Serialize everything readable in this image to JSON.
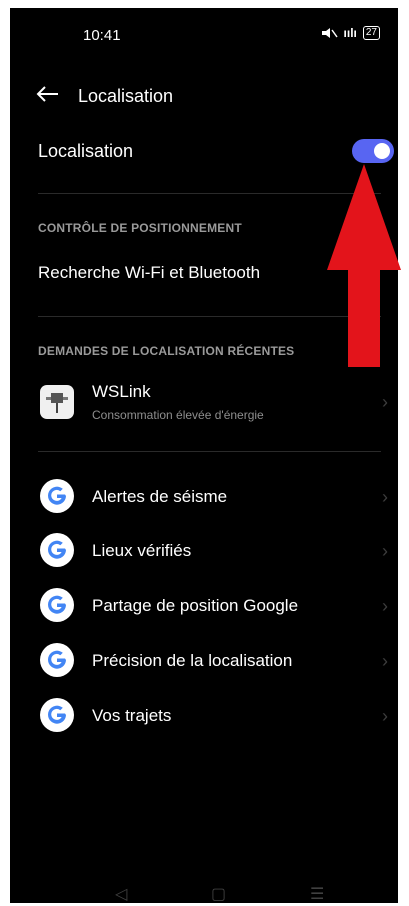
{
  "status": {
    "time": "10:41",
    "battery": "27",
    "signal": "ıılı"
  },
  "header": {
    "title": "Localisation"
  },
  "location_toggle": {
    "label": "Localisation",
    "on": true,
    "accent": "#5865F2"
  },
  "section_control": {
    "title": "CONTRÔLE DE POSITIONNEMENT",
    "item": "Recherche Wi-Fi et Bluetooth"
  },
  "section_recent": {
    "title": "DEMANDES DE LOCALISATION RÉCENTES",
    "wslink": {
      "name": "WSLink",
      "detail": "Consommation élevée d'énergie"
    }
  },
  "google_services": [
    {
      "label": "Alertes de séisme"
    },
    {
      "label": "Lieux vérifiés"
    },
    {
      "label": "Partage de position Google"
    },
    {
      "label": "Précision de la localisation"
    },
    {
      "label": "Vos trajets"
    }
  ],
  "nav_bar": {
    "back": "◁",
    "home": "▢",
    "recent": "☰"
  },
  "overlay": {
    "arrow_color": "#e3141b"
  }
}
